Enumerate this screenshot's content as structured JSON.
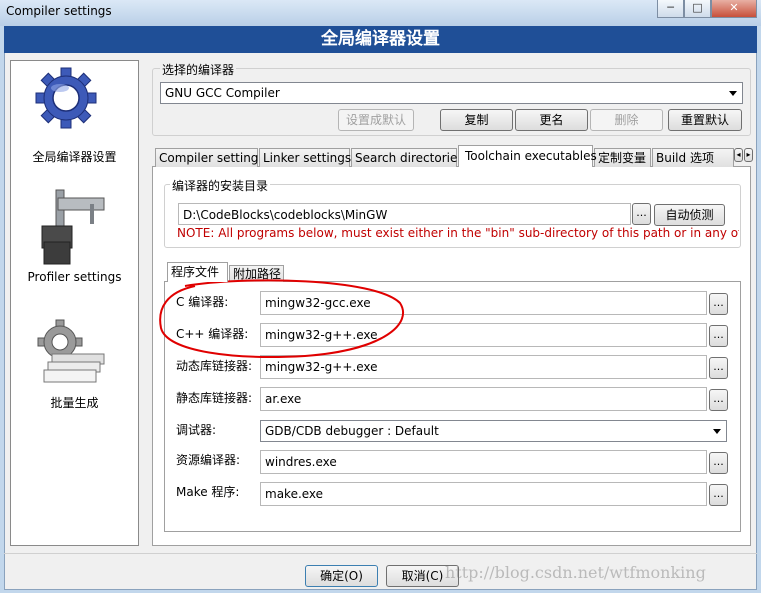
{
  "window": {
    "title": "Compiler settings",
    "minimize": "─",
    "maximize": "□",
    "close": "✕"
  },
  "header": {
    "title": "全局编译器设置"
  },
  "sidebar": {
    "items": [
      {
        "label": "全局编译器设置",
        "icon": "gear-icon"
      },
      {
        "label": "Profiler settings",
        "icon": "caliper-icon"
      },
      {
        "label": "批量生成",
        "icon": "stack-gear-icon"
      }
    ]
  },
  "compiler_select": {
    "group_label": "选择的编译器",
    "selected": "GNU GCC Compiler",
    "buttons": {
      "set_default": "设置成默认",
      "copy": "复制",
      "rename": "更名",
      "delete": "删除",
      "reset_defaults": "重置默认"
    }
  },
  "tabs": [
    "Compiler settings",
    "Linker settings",
    "Search directories",
    "Toolchain executables",
    "定制变量",
    "Build 选项"
  ],
  "active_tab": "Toolchain executables",
  "install_dir": {
    "group_label": "编译器的安装目录",
    "path": "D:\\CodeBlocks\\codeblocks\\MinGW",
    "browse": "...",
    "auto_detect": "自动侦测",
    "note": "NOTE: All programs below, must exist either in the \"bin\" sub-directory of this path or in any of the"
  },
  "subtabs": [
    "程序文件",
    "附加路径"
  ],
  "programs": [
    {
      "label": "C 编译器:",
      "value": "mingw32-gcc.exe"
    },
    {
      "label": "C++ 编译器:",
      "value": "mingw32-g++.exe"
    },
    {
      "label": "动态库链接器:",
      "value": "mingw32-g++.exe"
    },
    {
      "label": "静态库链接器:",
      "value": "ar.exe"
    },
    {
      "label": "调试器:",
      "value": "GDB/CDB debugger : Default"
    },
    {
      "label": "资源编译器:",
      "value": "windres.exe"
    },
    {
      "label": "Make 程序:",
      "value": "make.exe"
    }
  ],
  "footer": {
    "ok": "确定(O)",
    "cancel": "取消(C)"
  },
  "watermark": "http://blog.csdn.net/wtfmonking",
  "colors": {
    "header_bg": "#1f4f97",
    "note_text": "#c00000",
    "annotation_circle": "#e00000"
  }
}
